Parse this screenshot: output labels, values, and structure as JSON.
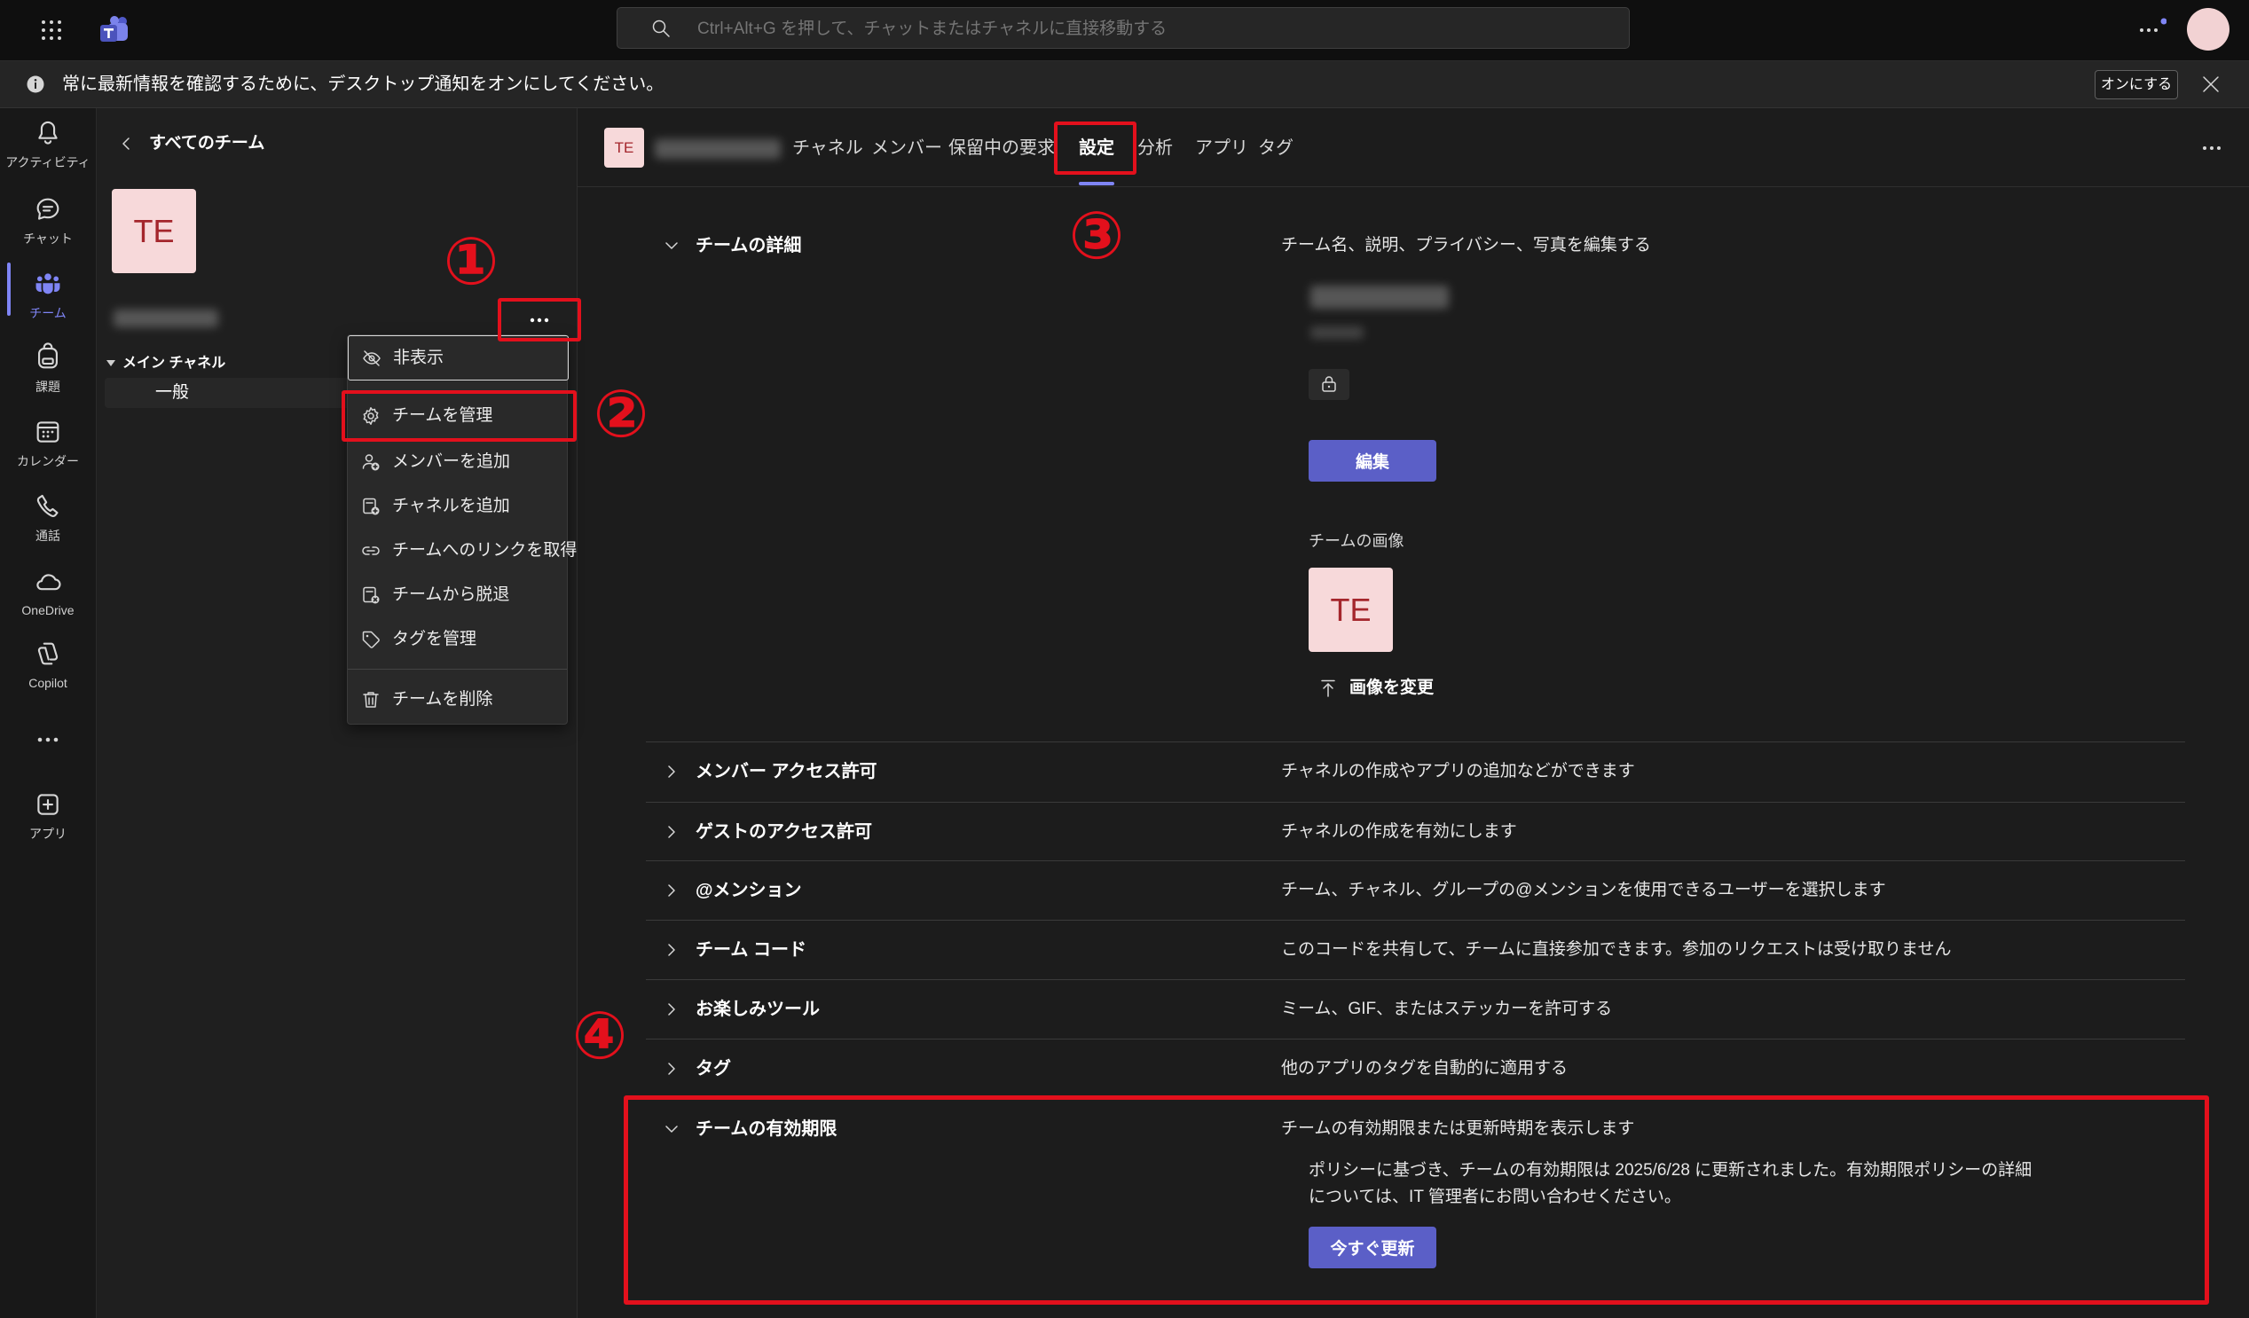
{
  "search": {
    "placeholder": "Ctrl+Alt+G を押して、チャットまたはチャネルに直接移動する",
    "icon": "search-icon"
  },
  "top_bar": {
    "app_launcher_icon": "waffle-icon",
    "logo": "teams-logo",
    "more_icon": "more-icon",
    "avatar_icon": "avatar"
  },
  "notification": {
    "icon": "info-icon",
    "text": "常に最新情報を確認するために、デスクトップ通知をオンにしてください。",
    "button_label": "オンにする",
    "close_icon": "close-icon"
  },
  "rail": {
    "items": [
      {
        "label": "アクティビティ",
        "icon": "bell-icon"
      },
      {
        "label": "チャット",
        "icon": "chat-icon"
      },
      {
        "label": "チーム",
        "icon": "teams-icon",
        "selected": true
      },
      {
        "label": "課題",
        "icon": "assignments-icon"
      },
      {
        "label": "カレンダー",
        "icon": "calendar-icon"
      },
      {
        "label": "通話",
        "icon": "phone-icon"
      },
      {
        "label": "OneDrive",
        "icon": "cloud-icon"
      },
      {
        "label": "Copilot",
        "icon": "copilot-icon"
      },
      {
        "label": "アプリ",
        "icon": "add-apps-icon"
      }
    ],
    "more_icon": "more-icon"
  },
  "left_panel": {
    "back_label": "すべてのチーム",
    "team_avatar_initials": "TE",
    "channel_group_label": "メイン チャネル",
    "channels": [
      "一般"
    ]
  },
  "context_menu": {
    "items": [
      {
        "label": "非表示",
        "icon": "hide-icon"
      },
      {
        "label": "チームを管理",
        "icon": "gear-icon"
      },
      {
        "label": "メンバーを追加",
        "icon": "add-member-icon"
      },
      {
        "label": "チャネルを追加",
        "icon": "add-channel-icon"
      },
      {
        "label": "チームへのリンクを取得",
        "icon": "link-icon"
      },
      {
        "label": "チームから脱退",
        "icon": "leave-icon"
      },
      {
        "label": "タグを管理",
        "icon": "tag-icon"
      },
      {
        "label": "チームを削除",
        "icon": "trash-icon"
      }
    ]
  },
  "header": {
    "team_avatar_initials": "TE",
    "tabs": [
      {
        "label": "チャネル"
      },
      {
        "label": "メンバー"
      },
      {
        "label": "保留中の要求"
      },
      {
        "label": "設定",
        "active": true
      },
      {
        "label": "分析"
      },
      {
        "label": "アプリ"
      },
      {
        "label": "タグ"
      }
    ]
  },
  "settings": {
    "team_details": {
      "title": "チームの詳細",
      "description": "チーム名、説明、プライバシー、写真を編集する",
      "privacy_icon": "lock-icon",
      "edit_button": "編集",
      "image_label": "チームの画像",
      "image_initials": "TE",
      "change_image_label": "画像を変更",
      "expanded": true
    },
    "rows": [
      {
        "title": "メンバー アクセス許可",
        "description": "チャネルの作成やアプリの追加などができます"
      },
      {
        "title": "ゲストのアクセス許可",
        "description": "チャネルの作成を有効にします"
      },
      {
        "title": "@メンション",
        "description": "チーム、チャネル、グループの@メンションを使用できるユーザーを選択します"
      },
      {
        "title": "チーム コード",
        "description": "このコードを共有して、チームに直接参加できます。参加のリクエストは受け取りません"
      },
      {
        "title": "お楽しみツール",
        "description": "ミーム、GIF、またはステッカーを許可する"
      },
      {
        "title": "タグ",
        "description": "他のアプリのタグを自動的に適用する"
      }
    ],
    "expiration": {
      "title": "チームの有効期限",
      "description": "チームの有効期限または更新時期を表示します",
      "body": "ポリシーに基づき、チームの有効期限は 2025/6/28 に更新されました。有効期限ポリシーの詳細については、IT 管理者にお問い合わせください。",
      "renew_button": "今すぐ更新",
      "expanded": true
    }
  },
  "annotations": {
    "markers": [
      "①",
      "②",
      "③",
      "④"
    ]
  },
  "colors": {
    "accent": "#5b5fc7",
    "accent_light": "#7f85f5",
    "annotation_red": "#e3101c",
    "avatar_bg": "#f7d9da",
    "avatar_text": "#a4262c"
  }
}
